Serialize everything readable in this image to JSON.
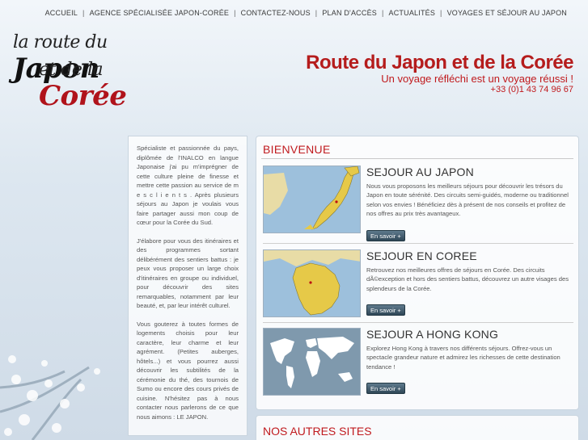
{
  "nav": {
    "items": [
      "ACCUEIL",
      "AGENCE SPÉCIALISÉE JAPON-CORÉE",
      "CONTACTEZ-NOUS",
      "PLAN D'ACCÈS",
      "ACTUALITÉS",
      "VOYAGES ET SÉJOUR AU JAPON"
    ],
    "separator": "|"
  },
  "logo": {
    "line1_prefix": "la route du ",
    "line1_big": "Japon",
    "line2_prefix": "et de la ",
    "line2_big": "Corée"
  },
  "header": {
    "title": "Route du Japon et de la Corée",
    "tagline": "Un voyage réfléchi est un voyage réussi !",
    "phone": "+33 (0)1 43 74 96 67"
  },
  "sidebar": {
    "paragraphs": [
      "Spécialiste et passionnée du pays, diplômée de l'INALCO en langue Japonaise j'ai pu m'imprégner de cette culture pleine de finesse et mettre cette passion au service de m e s c l i e n t s . Après plusieurs séjours au Japon je voulais vous faire partager aussi mon coup de cœur pour la Corée du Sud.",
      "J'élabore pour vous des itinéraires et des programmes sortant délibérément des sentiers battus : je peux vous proposer un large choix d'itinéraires en groupe ou individuel, pour découvrir des sites remarquables, notamment par leur beauté, et, par leur intérêt culturel.",
      "Vous gouterez à toutes formes de logements choisis pour leur caractère, leur charme et leur agrément. (Petites auberges, hôtels...) et vous pourrez aussi découvrir les subtilités de la cérémonie du thé, des tournois de Sumo ou encore des cours privés de cuisine. N'hésitez pas à nous contacter nous parlerons de ce que nous aimons : LE JAPON."
    ]
  },
  "main": {
    "heading": "BIENVENUE",
    "cards": [
      {
        "title": "SEJOUR AU JAPON",
        "text": "Nous vous proposons les meilleurs séjours pour découvrir les trésors du Japon en toute sérénité. Des circuits semi-guidés, moderne ou traditionnel selon vos envies ! Bénéficiez dès à présent de nos conseils et profitez de nos offres au prix très avantageux.",
        "button": "En savoir +",
        "image_icon": "japan-map-icon"
      },
      {
        "title": "SEJOUR EN COREE",
        "text": "Retrouvez nos meilleures offres de séjours en Corée. Des circuits dÃ©exception et hors des sentiers battus, découvrez un autre visages des splendeurs de la Corée.",
        "button": "En savoir +",
        "image_icon": "korea-map-icon"
      },
      {
        "title": "SEJOUR A HONG KONG",
        "text": "Explorez Hong Kong à travers nos différents séjours. Offrez-vous un spectacle grandeur nature et admirez les richesses de cette destination tendance !",
        "button": "En savoir +",
        "image_icon": "world-map-icon"
      }
    ]
  },
  "other": {
    "heading": "NOS AUTRES SITES"
  },
  "colors": {
    "accent_red": "#c01a1e",
    "button_dark": "#2f4757"
  }
}
